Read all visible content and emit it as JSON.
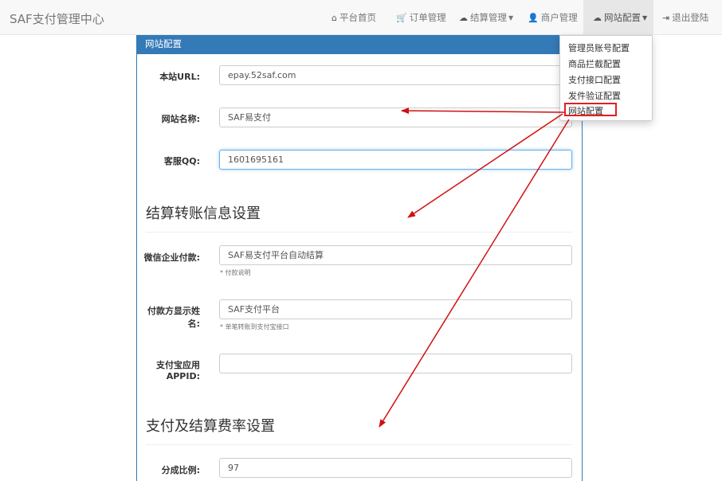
{
  "navbar": {
    "brand": "SAF支付管理中心",
    "items": [
      {
        "label": "平台首页",
        "icon": "home-icon"
      },
      {
        "label": "订单管理",
        "icon": "cart-icon"
      },
      {
        "label": "结算管理",
        "icon": "cloud-icon"
      },
      {
        "label": "商户管理",
        "icon": "user-icon"
      },
      {
        "label": "网站配置",
        "icon": "cloud-icon"
      },
      {
        "label": "退出登陆",
        "icon": "logout-icon"
      }
    ]
  },
  "dropdown": {
    "items": [
      "管理员账号配置",
      "商品拦截配置",
      "支付接口配置",
      "发件验证配置",
      "网站配置"
    ]
  },
  "panel": {
    "heading": "网站配置",
    "fields": {
      "site_url": {
        "label": "本站URL:",
        "value": "epay.52saf.com"
      },
      "site_name": {
        "label": "网站名称:",
        "value": "SAF易支付"
      },
      "service_qq": {
        "label": "客服QQ:",
        "value": "1601695161"
      }
    },
    "transfer_section": {
      "title": "结算转账信息设置",
      "wechat_pay": {
        "label": "微信企业付款:",
        "value": "SAF易支付平台自动结算",
        "help": "* 付款说明"
      },
      "payer_name": {
        "label_line1": "付款方显示姓",
        "label_line2": "名:",
        "value": "SAF支付平台",
        "help": "* 单笔转账到支付宝接口"
      },
      "alipay_appid": {
        "label_line1": "支付宝应用",
        "label_line2": "APPID:",
        "value": ""
      }
    },
    "rate_section": {
      "title": "支付及结算费率设置",
      "split_ratio": {
        "label": "分成比例:",
        "value": "97"
      }
    }
  },
  "annotation_color": "#d01010"
}
